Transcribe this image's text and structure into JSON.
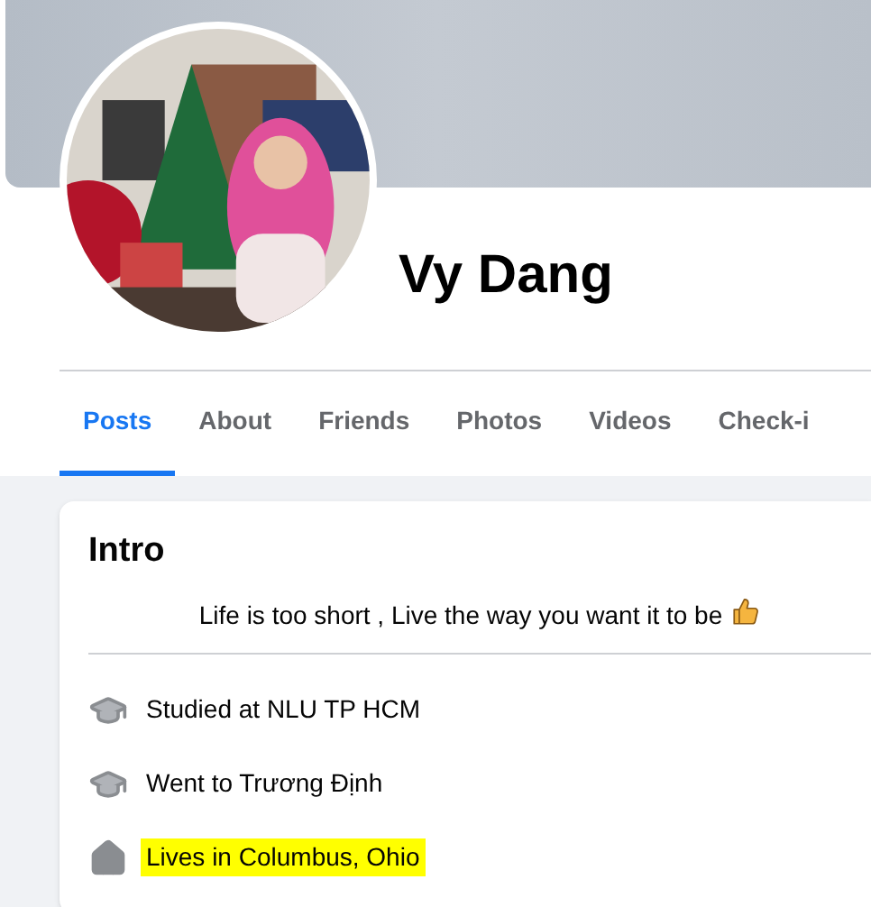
{
  "profile": {
    "name": "Vy Dang"
  },
  "tabs": [
    {
      "label": "Posts",
      "selected": true
    },
    {
      "label": "About",
      "selected": false
    },
    {
      "label": "Friends",
      "selected": false
    },
    {
      "label": "Photos",
      "selected": false
    },
    {
      "label": "Videos",
      "selected": false
    },
    {
      "label": "Check-i",
      "selected": false
    }
  ],
  "intro": {
    "title": "Intro",
    "bio": "Life is too short , Live the way you want it to be",
    "items": [
      {
        "kind": "education",
        "text": "Studied at NLU TP HCM",
        "highlighted": false
      },
      {
        "kind": "education",
        "text": "Went to Trương Định",
        "highlighted": false
      },
      {
        "kind": "home",
        "text": "Lives in Columbus, Ohio",
        "highlighted": true
      }
    ]
  }
}
